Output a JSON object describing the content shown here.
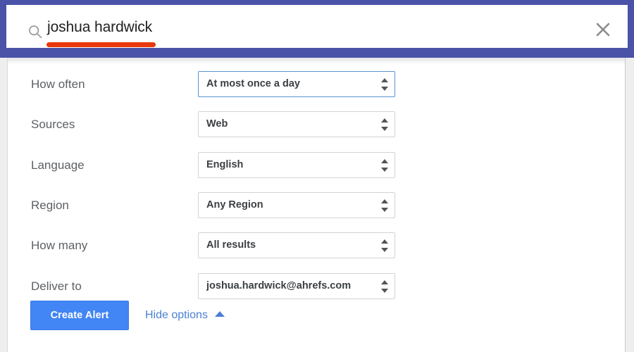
{
  "search": {
    "query": "joshua hardwick",
    "icon": "search-icon",
    "close_icon": "close-icon",
    "highlight_color": "#e8380d",
    "frame_color": "#4a53a8"
  },
  "form": {
    "rows": [
      {
        "label": "How often",
        "value": "At most once a day",
        "focused": true
      },
      {
        "label": "Sources",
        "value": "Web",
        "focused": false
      },
      {
        "label": "Language",
        "value": "English",
        "focused": false
      },
      {
        "label": "Region",
        "value": "Any Region",
        "focused": false
      },
      {
        "label": "How many",
        "value": "All results",
        "focused": false
      },
      {
        "label": "Deliver to",
        "value": "joshua.hardwick@ahrefs.com",
        "focused": false
      }
    ]
  },
  "actions": {
    "create_label": "Create Alert",
    "hide_options_label": "Hide options",
    "create_color": "#4285f4",
    "link_color": "#4a7fd4"
  }
}
